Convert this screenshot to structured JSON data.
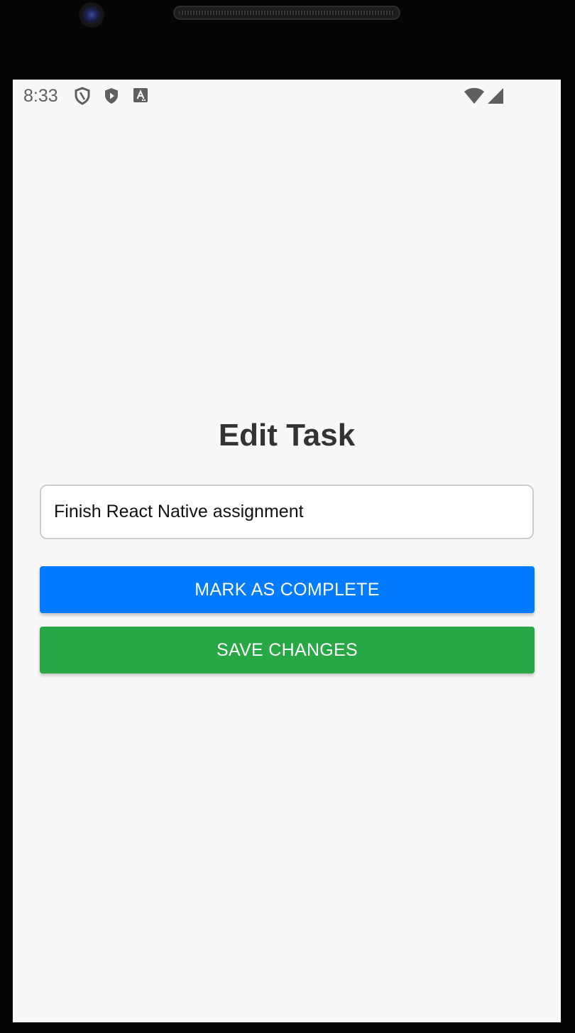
{
  "status_bar": {
    "time": "8:33",
    "icons": [
      "shield-outline-icon",
      "shield-play-icon",
      "font-a-icon",
      "wifi-icon",
      "cellular-signal-icon"
    ]
  },
  "screen": {
    "title": "Edit Task",
    "task_input": {
      "value": "Finish React Native assignment",
      "placeholder": ""
    },
    "mark_complete_label": "MARK AS COMPLETE",
    "save_label": "SAVE CHANGES"
  },
  "colors": {
    "background": "#f8f8f8",
    "primary_blue": "#007bff",
    "success_green": "#28a745",
    "title_text": "#333333"
  }
}
